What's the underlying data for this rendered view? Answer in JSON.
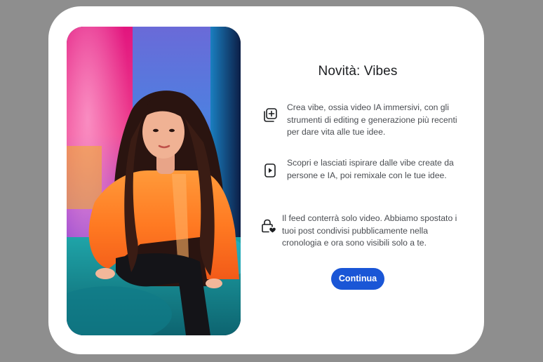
{
  "modal": {
    "title": "Novità: Vibes",
    "features": [
      {
        "icon": "add-media-icon",
        "text": "Crea vibe, ossia video IA immersivi, con gli strumenti di editing e generazione più recenti per dare vita alle tue idee."
      },
      {
        "icon": "play-icon",
        "text": "Scopri e lasciati ispirare dalle vibe create da persone e IA, poi remixale con le tue idee."
      },
      {
        "icon": "lock-heart-icon",
        "text": "Il feed conterrà solo video. Abbiamo spostato i tuoi post condivisi pubblicamente nella cronologia e ora sono visibili solo a te."
      }
    ],
    "continue_label": "Continua"
  },
  "colors": {
    "background": "#8e8e8e",
    "modal": "#ffffff",
    "button": "#1a56d6",
    "title_text": "#1c1e21",
    "body_text": "#4a4d52"
  }
}
